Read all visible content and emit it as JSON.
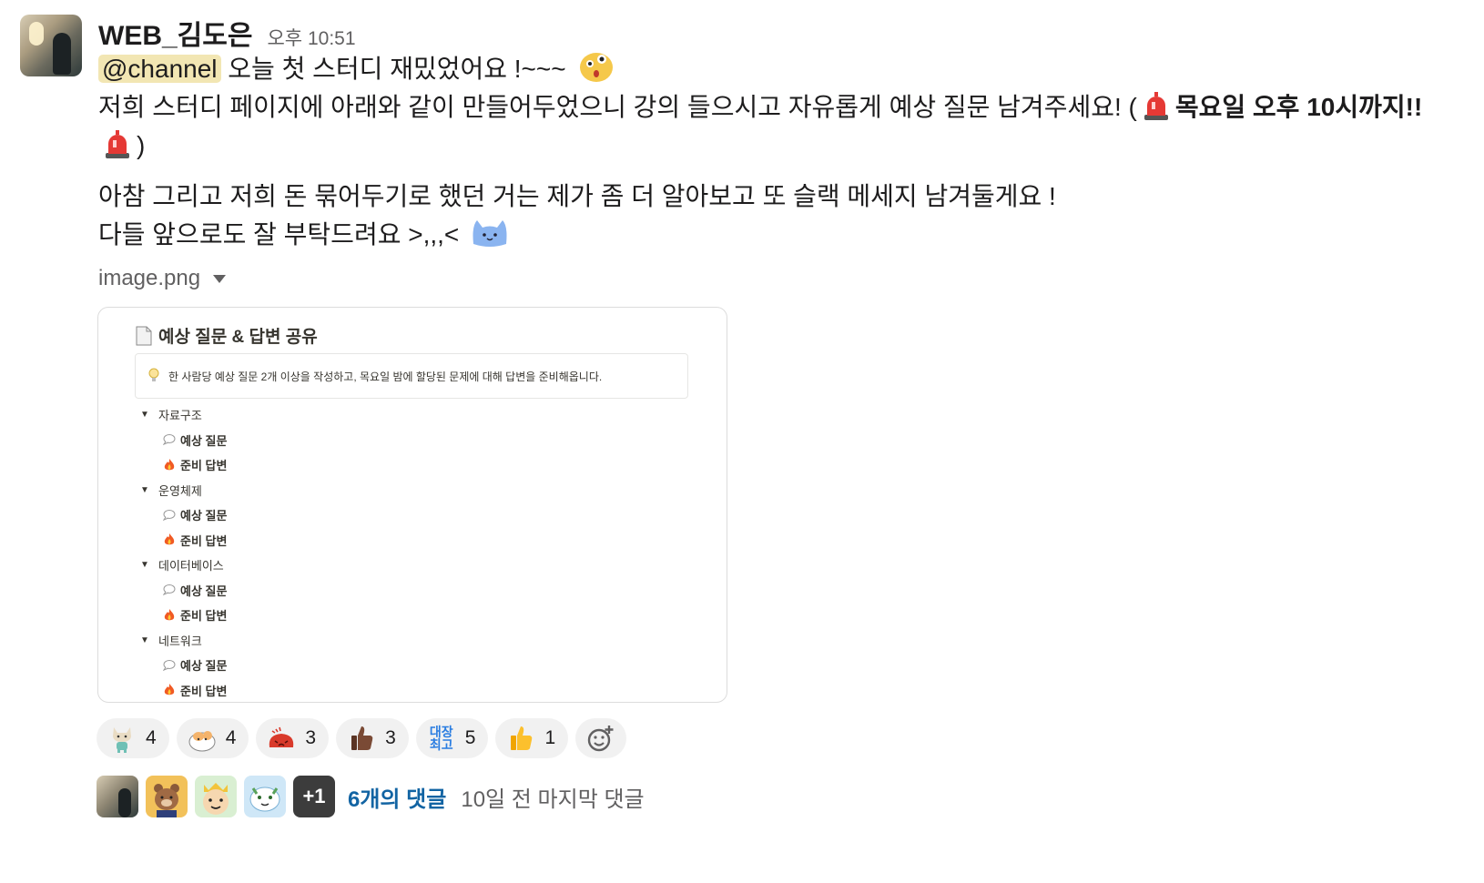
{
  "message": {
    "username": "WEB_김도은",
    "timestamp": "오후 10:51",
    "mention": "@channel",
    "line1": "오늘 첫 스터디 재밌었어요 !~~~",
    "line2_text": "저희 스터디 페이지에 아래와 같이 만들어두었으니 강의 들으시고 자유롭게 예상 질문 남겨주세요! (",
    "line2_bold": "목요일 오후 10시까지!!",
    "line2_close": ")",
    "line3": "아참 그리고 저희 돈 묶어두기로 했던 거는 제가 좀 더 알아보고 또 슬랙 메세지 남겨둘게요 !",
    "line4": "다들 앞으로도 잘 부탁드려요 >,,,<"
  },
  "attachment": {
    "filename": "image.png",
    "preview": {
      "title": "예상 질문 & 답변 공유",
      "callout": "한 사람당 예상 질문 2개 이상을 작성하고, 목요일 밤에 할당된 문제에 대해 답변을 준비해옵니다.",
      "sections": [
        {
          "label": "자료구조",
          "items": [
            "예상 질문",
            "준비 답변"
          ]
        },
        {
          "label": "운영체제",
          "items": [
            "예상 질문",
            "준비 답변"
          ]
        },
        {
          "label": "데이터베이스",
          "items": [
            "예상 질문",
            "준비 답변"
          ]
        },
        {
          "label": "네트워크",
          "items": [
            "예상 질문",
            "준비 답변"
          ]
        }
      ]
    }
  },
  "reactions": [
    {
      "icon": "cat-character-emoji",
      "count": "4"
    },
    {
      "icon": "hamster-emoji",
      "count": "4"
    },
    {
      "icon": "red-blob-emoji",
      "count": "3"
    },
    {
      "icon": "thumbs-up-dark-emoji",
      "count": "3"
    },
    {
      "icon_text": "대장\n최고",
      "count": "5"
    },
    {
      "icon": "thumbs-up-emoji",
      "count": "1"
    }
  ],
  "thread": {
    "more_avatars": "+1",
    "reply_count": "6개의 댓글",
    "last_reply": "10일 전 마지막 댓글"
  },
  "colors": {
    "mention_bg": "#f2e6b3",
    "link": "#1264a3",
    "secondary_text": "#616061",
    "reaction_bg": "#f1f1f1"
  }
}
